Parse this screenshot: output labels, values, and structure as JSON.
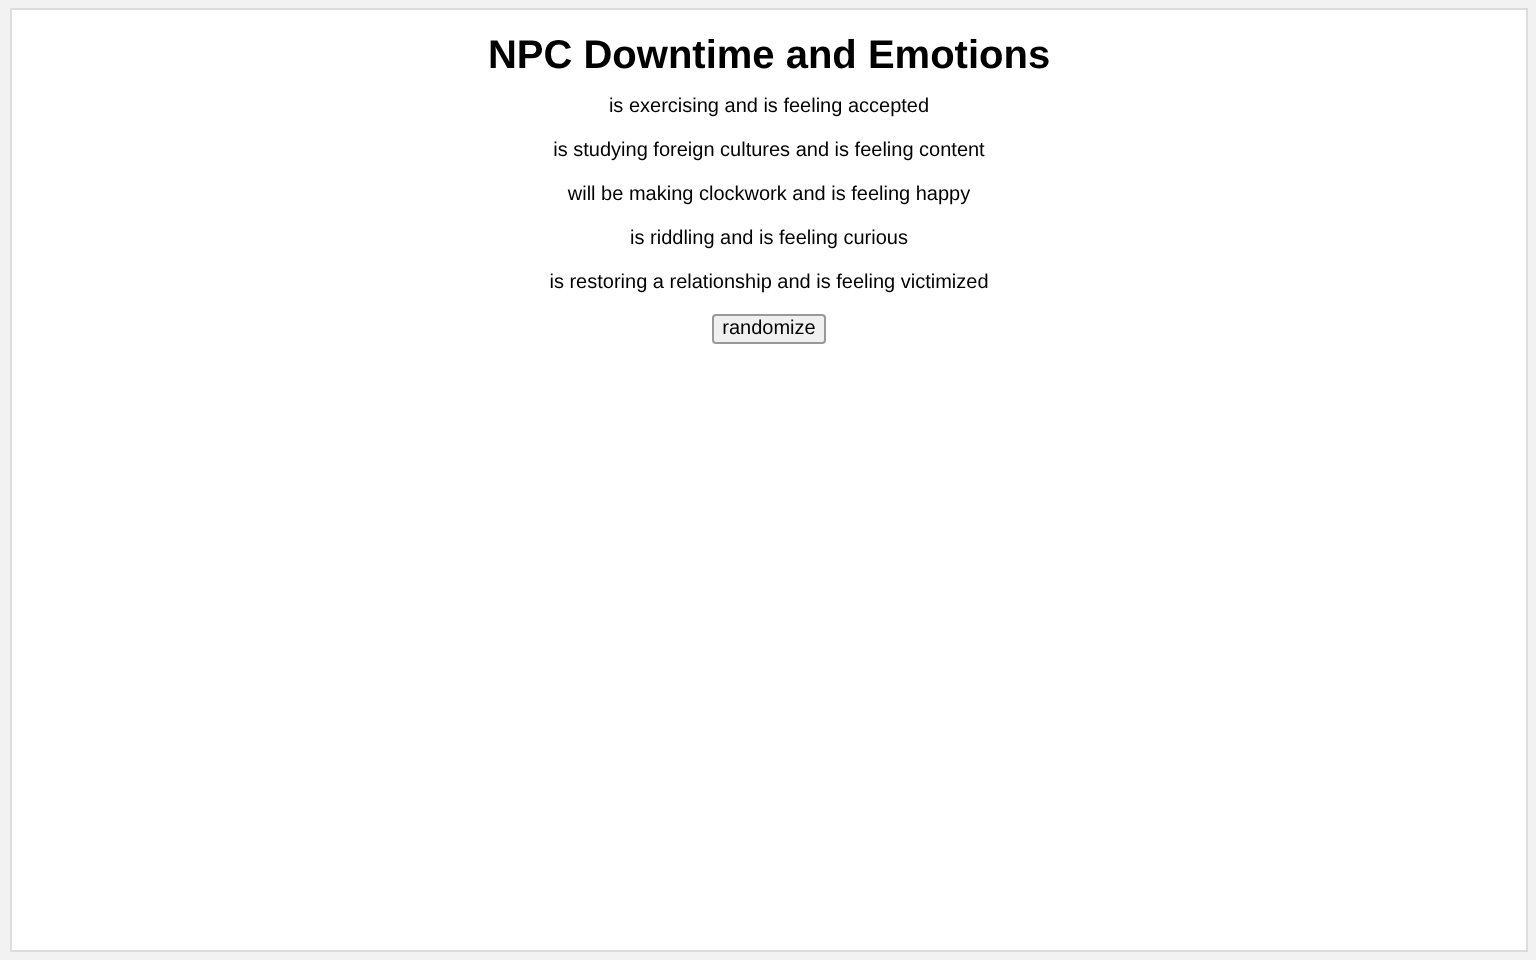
{
  "title": "NPC Downtime and Emotions",
  "lines": [
    "is exercising and is feeling accepted",
    "is studying foreign cultures and is feeling content",
    "will be making clockwork and is feeling happy",
    "is riddling and is feeling curious",
    "is restoring a relationship and is feeling victimized"
  ],
  "button": "randomize"
}
